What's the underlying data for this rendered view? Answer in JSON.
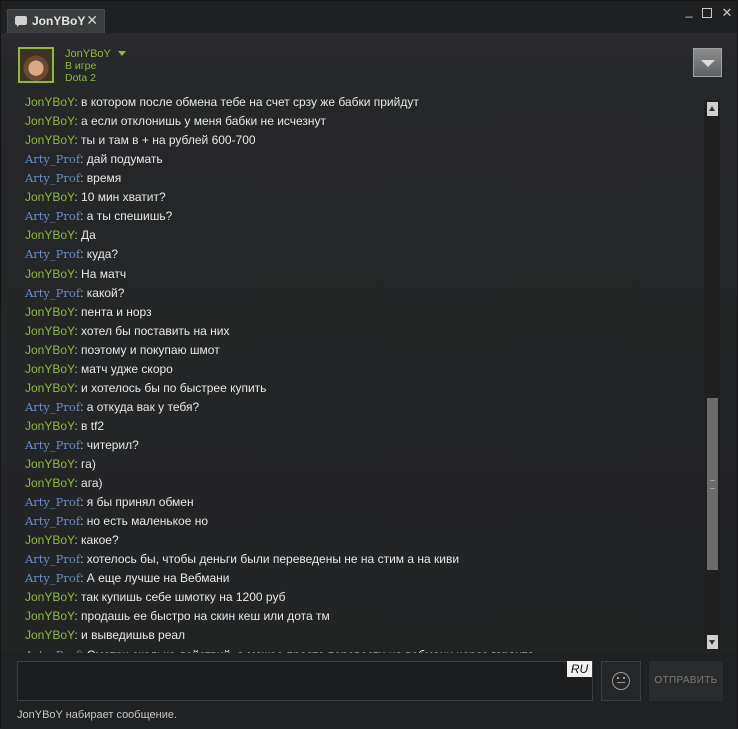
{
  "window": {
    "tab_label": "JonYBoY",
    "tab_close": "✕",
    "minimize": "_",
    "close": "✕"
  },
  "friend": {
    "name": "JonYBoY",
    "status": "В игре",
    "game": "Dota 2"
  },
  "messages": [
    {
      "sender": "JonYBoY",
      "text": "в котором после обмена тебе на счет срзу же бабки прийдут"
    },
    {
      "sender": "JonYBoY",
      "text": "а если отклонишь у меня бабки не исчезнут"
    },
    {
      "sender": "JonYBoY",
      "text": "ты и там в + на рублей 600-700"
    },
    {
      "sender": "Arty_Prof",
      "text": "дай подумать"
    },
    {
      "sender": "Arty_Prof",
      "text": "время"
    },
    {
      "sender": "JonYBoY",
      "text": "10 мин хватит?"
    },
    {
      "sender": "Arty_Prof",
      "text": "а ты спешишь?"
    },
    {
      "sender": "JonYBoY",
      "text": "Да"
    },
    {
      "sender": "Arty_Prof",
      "text": "куда?"
    },
    {
      "sender": "JonYBoY",
      "text": "На матч"
    },
    {
      "sender": "Arty_Prof",
      "text": "какой?"
    },
    {
      "sender": "JonYBoY",
      "text": "пента и норз"
    },
    {
      "sender": "JonYBoY",
      "text": "хотел бы поставить на них"
    },
    {
      "sender": "JonYBoY",
      "text": "поэтому и покупаю шмот"
    },
    {
      "sender": "JonYBoY",
      "text": "матч удже скоро"
    },
    {
      "sender": "JonYBoY",
      "text": "и хотелось бы по быстрее купить"
    },
    {
      "sender": "Arty_Prof",
      "text": "а откуда вак у тебя?"
    },
    {
      "sender": "JonYBoY",
      "text": "в tf2"
    },
    {
      "sender": "Arty_Prof",
      "text": "читерил?"
    },
    {
      "sender": "JonYBoY",
      "text": "га)"
    },
    {
      "sender": "JonYBoY",
      "text": "ага)"
    },
    {
      "sender": "Arty_Prof",
      "text": "я бы принял обмен"
    },
    {
      "sender": "Arty_Prof",
      "text": "но есть маленькое но"
    },
    {
      "sender": "JonYBoY",
      "text": "какое?"
    },
    {
      "sender": "Arty_Prof",
      "text": "хотелось бы, чтобы деньги были переведены не на стим а на киви"
    },
    {
      "sender": "Arty_Prof",
      "text": "А еще лучше на Вебмани"
    },
    {
      "sender": "JonYBoY",
      "text": "так купишь себе шмотку на 1200 руб"
    },
    {
      "sender": "JonYBoY",
      "text": "продашь ее быстро на скин кеш или дота тм"
    },
    {
      "sender": "JonYBoY",
      "text": "и выведишьв реал"
    },
    {
      "sender": "Arty_Prof",
      "text": "Смотри сколько действий, а можео просто перевести на вебмани через гаранта"
    }
  ],
  "composer": {
    "lang": "RU",
    "send_label": "ОТПРАВИТЬ"
  },
  "typing_status": "JonYBoY набирает сообщение.",
  "colors": {
    "self_sender": "#8fb93b",
    "other_sender": "#6d8dc6",
    "background": "#232425"
  },
  "icons": [
    "chat-icon",
    "close-icon",
    "minimize-icon",
    "maximize-icon",
    "chevron-down-icon",
    "emoticon-icon"
  ]
}
